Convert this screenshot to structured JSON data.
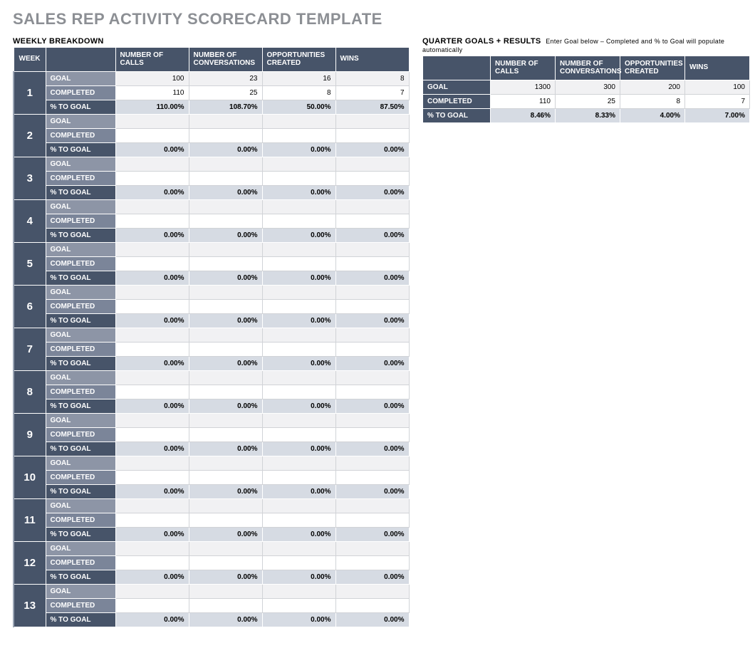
{
  "title": "SALES REP ACTIVITY SCORECARD TEMPLATE",
  "weekly": {
    "heading": "WEEKLY BREAKDOWN",
    "headers": {
      "week": "WEEK",
      "calls": "NUMBER OF CALLS",
      "conversations": "NUMBER OF CONVERSATIONS",
      "opportunities": "OPPORTUNITIES CREATED",
      "wins": "WINS"
    },
    "row_labels": {
      "goal": "GOAL",
      "completed": "COMPLETED",
      "pct": "% TO GOAL"
    },
    "weeks": [
      {
        "num": "1",
        "goal": {
          "calls": "100",
          "conv": "23",
          "opp": "16",
          "wins": "8"
        },
        "completed": {
          "calls": "110",
          "conv": "25",
          "opp": "8",
          "wins": "7"
        },
        "pct": {
          "calls": "110.00%",
          "conv": "108.70%",
          "opp": "50.00%",
          "wins": "87.50%"
        }
      },
      {
        "num": "2",
        "goal": {
          "calls": "",
          "conv": "",
          "opp": "",
          "wins": ""
        },
        "completed": {
          "calls": "",
          "conv": "",
          "opp": "",
          "wins": ""
        },
        "pct": {
          "calls": "0.00%",
          "conv": "0.00%",
          "opp": "0.00%",
          "wins": "0.00%"
        }
      },
      {
        "num": "3",
        "goal": {
          "calls": "",
          "conv": "",
          "opp": "",
          "wins": ""
        },
        "completed": {
          "calls": "",
          "conv": "",
          "opp": "",
          "wins": ""
        },
        "pct": {
          "calls": "0.00%",
          "conv": "0.00%",
          "opp": "0.00%",
          "wins": "0.00%"
        }
      },
      {
        "num": "4",
        "goal": {
          "calls": "",
          "conv": "",
          "opp": "",
          "wins": ""
        },
        "completed": {
          "calls": "",
          "conv": "",
          "opp": "",
          "wins": ""
        },
        "pct": {
          "calls": "0.00%",
          "conv": "0.00%",
          "opp": "0.00%",
          "wins": "0.00%"
        }
      },
      {
        "num": "5",
        "goal": {
          "calls": "",
          "conv": "",
          "opp": "",
          "wins": ""
        },
        "completed": {
          "calls": "",
          "conv": "",
          "opp": "",
          "wins": ""
        },
        "pct": {
          "calls": "0.00%",
          "conv": "0.00%",
          "opp": "0.00%",
          "wins": "0.00%"
        }
      },
      {
        "num": "6",
        "goal": {
          "calls": "",
          "conv": "",
          "opp": "",
          "wins": ""
        },
        "completed": {
          "calls": "",
          "conv": "",
          "opp": "",
          "wins": ""
        },
        "pct": {
          "calls": "0.00%",
          "conv": "0.00%",
          "opp": "0.00%",
          "wins": "0.00%"
        }
      },
      {
        "num": "7",
        "goal": {
          "calls": "",
          "conv": "",
          "opp": "",
          "wins": ""
        },
        "completed": {
          "calls": "",
          "conv": "",
          "opp": "",
          "wins": ""
        },
        "pct": {
          "calls": "0.00%",
          "conv": "0.00%",
          "opp": "0.00%",
          "wins": "0.00%"
        }
      },
      {
        "num": "8",
        "goal": {
          "calls": "",
          "conv": "",
          "opp": "",
          "wins": ""
        },
        "completed": {
          "calls": "",
          "conv": "",
          "opp": "",
          "wins": ""
        },
        "pct": {
          "calls": "0.00%",
          "conv": "0.00%",
          "opp": "0.00%",
          "wins": "0.00%"
        }
      },
      {
        "num": "9",
        "goal": {
          "calls": "",
          "conv": "",
          "opp": "",
          "wins": ""
        },
        "completed": {
          "calls": "",
          "conv": "",
          "opp": "",
          "wins": ""
        },
        "pct": {
          "calls": "0.00%",
          "conv": "0.00%",
          "opp": "0.00%",
          "wins": "0.00%"
        }
      },
      {
        "num": "10",
        "goal": {
          "calls": "",
          "conv": "",
          "opp": "",
          "wins": ""
        },
        "completed": {
          "calls": "",
          "conv": "",
          "opp": "",
          "wins": ""
        },
        "pct": {
          "calls": "0.00%",
          "conv": "0.00%",
          "opp": "0.00%",
          "wins": "0.00%"
        }
      },
      {
        "num": "11",
        "goal": {
          "calls": "",
          "conv": "",
          "opp": "",
          "wins": ""
        },
        "completed": {
          "calls": "",
          "conv": "",
          "opp": "",
          "wins": ""
        },
        "pct": {
          "calls": "0.00%",
          "conv": "0.00%",
          "opp": "0.00%",
          "wins": "0.00%"
        }
      },
      {
        "num": "12",
        "goal": {
          "calls": "",
          "conv": "",
          "opp": "",
          "wins": ""
        },
        "completed": {
          "calls": "",
          "conv": "",
          "opp": "",
          "wins": ""
        },
        "pct": {
          "calls": "0.00%",
          "conv": "0.00%",
          "opp": "0.00%",
          "wins": "0.00%"
        }
      },
      {
        "num": "13",
        "goal": {
          "calls": "",
          "conv": "",
          "opp": "",
          "wins": ""
        },
        "completed": {
          "calls": "",
          "conv": "",
          "opp": "",
          "wins": ""
        },
        "pct": {
          "calls": "0.00%",
          "conv": "0.00%",
          "opp": "0.00%",
          "wins": "0.00%"
        }
      }
    ]
  },
  "quarter": {
    "heading": "QUARTER GOALS + RESULTS",
    "subtext": "Enter Goal below – Completed and % to Goal will populate automatically",
    "headers": {
      "calls": "NUMBER OF CALLS",
      "conversations": "NUMBER OF CONVERSATIONS",
      "opportunities": "OPPORTUNITIES CREATED",
      "wins": "WINS"
    },
    "rows": {
      "goal": {
        "label": "GOAL",
        "calls": "1300",
        "conv": "300",
        "opp": "200",
        "wins": "100"
      },
      "completed": {
        "label": "COMPLETED",
        "calls": "110",
        "conv": "25",
        "opp": "8",
        "wins": "7"
      },
      "pct": {
        "label": "% TO GOAL",
        "calls": "8.46%",
        "conv": "8.33%",
        "opp": "4.00%",
        "wins": "7.00%"
      }
    }
  }
}
